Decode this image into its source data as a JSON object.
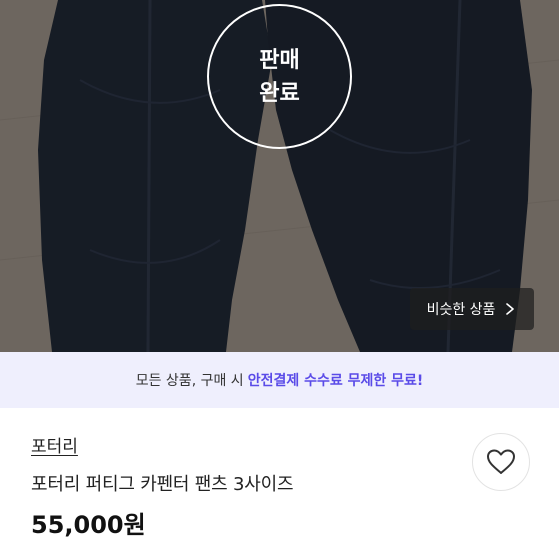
{
  "photo": {
    "sold_badge_line1": "판매",
    "sold_badge_line2": "완료",
    "similar_button_label": "비슷한 상품",
    "similar_button_icon": "chevron-right-icon"
  },
  "promo": {
    "text_prefix": "모든 상품, 구매 시",
    "text_highlight": "안전결제 수수료 무제한 무료!",
    "highlight_color": "#5a4be8",
    "background_color": "#efeffd"
  },
  "product": {
    "brand": "포터리",
    "title": "포터리 퍼티그 카펜터 팬츠 3사이즈",
    "price": "55,000원",
    "wishlist_icon": "heart-icon"
  }
}
